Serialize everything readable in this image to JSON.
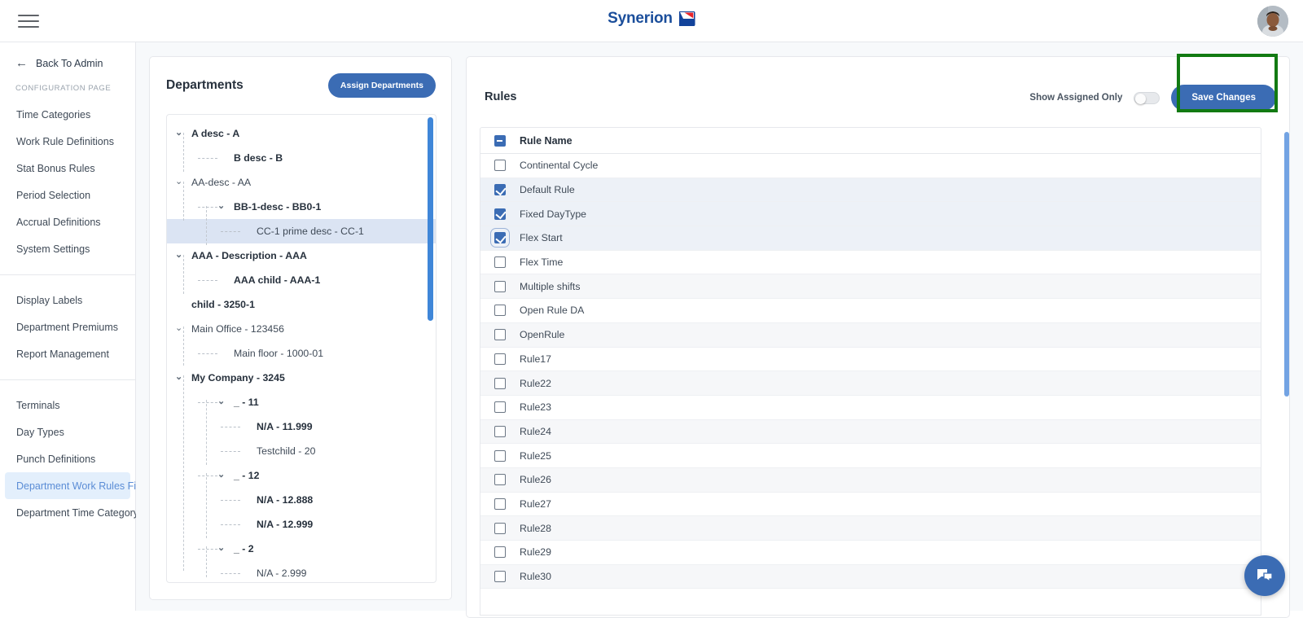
{
  "topbar": {
    "menu_icon": "hamburger-menu-icon",
    "brand_name": "Synerion",
    "brand_mark_icon": "synerion-arrow-logo",
    "brand_color": "#1b4e9b",
    "avatar_icon": "user-avatar"
  },
  "sidebar": {
    "back_label": "Back To Admin",
    "back_icon": "arrow-left-icon",
    "section_caption": "CONFIGURATION PAGE",
    "group1": [
      {
        "label": "Time Categories"
      },
      {
        "label": "Work Rule Definitions"
      },
      {
        "label": "Stat Bonus Rules"
      },
      {
        "label": "Period Selection"
      },
      {
        "label": "Accrual Definitions"
      },
      {
        "label": "System Settings"
      }
    ],
    "group2": [
      {
        "label": "Display Labels"
      },
      {
        "label": "Department Premiums"
      },
      {
        "label": "Report Management"
      }
    ],
    "group3": [
      {
        "label": "Terminals"
      },
      {
        "label": "Day Types"
      },
      {
        "label": "Punch Definitions"
      },
      {
        "label": "Department Work Rules Filt...",
        "active": true
      },
      {
        "label": "Department Time Category ..."
      }
    ],
    "active_bg": "#e3effc",
    "active_fg": "#5b8dd6"
  },
  "departments": {
    "title": "Departments",
    "assign_button": "Assign Departments",
    "tree": [
      {
        "label": "A desc - A",
        "depth": 0,
        "bold": true,
        "expanded": true,
        "chevron": "chevron-down-icon"
      },
      {
        "label": "B desc - B",
        "depth": 1,
        "bold": true,
        "expanded": null,
        "chevron": "none"
      },
      {
        "label": "AA-desc - AA",
        "depth": 0,
        "bold": false,
        "expanded": true,
        "chevron": "chevron-down-icon"
      },
      {
        "label": "BB-1-desc - BB0-1",
        "depth": 1,
        "bold": true,
        "expanded": true,
        "chevron": "chevron-down-icon"
      },
      {
        "label": "CC-1 prime desc - CC-1",
        "depth": 2,
        "bold": false,
        "expanded": null,
        "chevron": "none",
        "selected": true
      },
      {
        "label": "AAA - Description - AAA",
        "depth": 0,
        "bold": true,
        "expanded": true,
        "chevron": "chevron-down-icon"
      },
      {
        "label": "AAA child - AAA-1",
        "depth": 1,
        "bold": true,
        "expanded": null,
        "chevron": "none"
      },
      {
        "label": "child - 3250-1",
        "depth": 0,
        "bold": true,
        "expanded": null,
        "chevron": "none",
        "noline": true
      },
      {
        "label": "Main Office - 123456",
        "depth": 0,
        "bold": false,
        "expanded": true,
        "chevron": "chevron-down-icon"
      },
      {
        "label": "Main floor - 1000-01",
        "depth": 1,
        "bold": false,
        "expanded": null,
        "chevron": "none"
      },
      {
        "label": "My Company - 3245",
        "depth": 0,
        "bold": true,
        "expanded": true,
        "chevron": "chevron-down-icon"
      },
      {
        "label": "_ - 11",
        "depth": 1,
        "bold": true,
        "expanded": true,
        "chevron": "chevron-down-icon"
      },
      {
        "label": "N/A - 11.999",
        "depth": 2,
        "bold": true,
        "expanded": null,
        "chevron": "none"
      },
      {
        "label": "Testchild - 20",
        "depth": 2,
        "bold": false,
        "expanded": null,
        "chevron": "none"
      },
      {
        "label": "_ - 12",
        "depth": 1,
        "bold": true,
        "expanded": true,
        "chevron": "chevron-down-icon"
      },
      {
        "label": "N/A - 12.888",
        "depth": 2,
        "bold": true,
        "expanded": null,
        "chevron": "none"
      },
      {
        "label": "N/A - 12.999",
        "depth": 2,
        "bold": true,
        "expanded": null,
        "chevron": "none"
      },
      {
        "label": "_ - 2",
        "depth": 1,
        "bold": true,
        "expanded": true,
        "chevron": "chevron-down-icon"
      },
      {
        "label": "N/A - 2.999",
        "depth": 2,
        "bold": false,
        "expanded": null,
        "chevron": "none"
      }
    ],
    "scrollbar_color": "#3f86d8"
  },
  "rules": {
    "title": "Rules",
    "toggle_label": "Show Assigned Only",
    "toggle_state": "off",
    "save_button": "Save Changes",
    "save_highlight_color": "#127a12",
    "accent_color": "#3b6cb4",
    "column_header": "Rule Name",
    "header_checkbox_state": "indeterminate",
    "items": [
      {
        "label": "Continental Cycle",
        "checked": false
      },
      {
        "label": "Default Rule",
        "checked": true
      },
      {
        "label": "Fixed DayType",
        "checked": true
      },
      {
        "label": "Flex Start",
        "checked": true,
        "focused": true
      },
      {
        "label": "Flex Time",
        "checked": false
      },
      {
        "label": "Multiple shifts",
        "checked": false
      },
      {
        "label": "Open Rule DA",
        "checked": false
      },
      {
        "label": "OpenRule",
        "checked": false
      },
      {
        "label": "Rule17",
        "checked": false
      },
      {
        "label": "Rule22",
        "checked": false
      },
      {
        "label": "Rule23",
        "checked": false
      },
      {
        "label": "Rule24",
        "checked": false
      },
      {
        "label": "Rule25",
        "checked": false
      },
      {
        "label": "Rule26",
        "checked": false
      },
      {
        "label": "Rule27",
        "checked": false
      },
      {
        "label": "Rule28",
        "checked": false
      },
      {
        "label": "Rule29",
        "checked": false
      },
      {
        "label": "Rule30",
        "checked": false
      }
    ]
  },
  "chat": {
    "icon": "chat-bubble-icon",
    "color": "#3b6cb4"
  }
}
